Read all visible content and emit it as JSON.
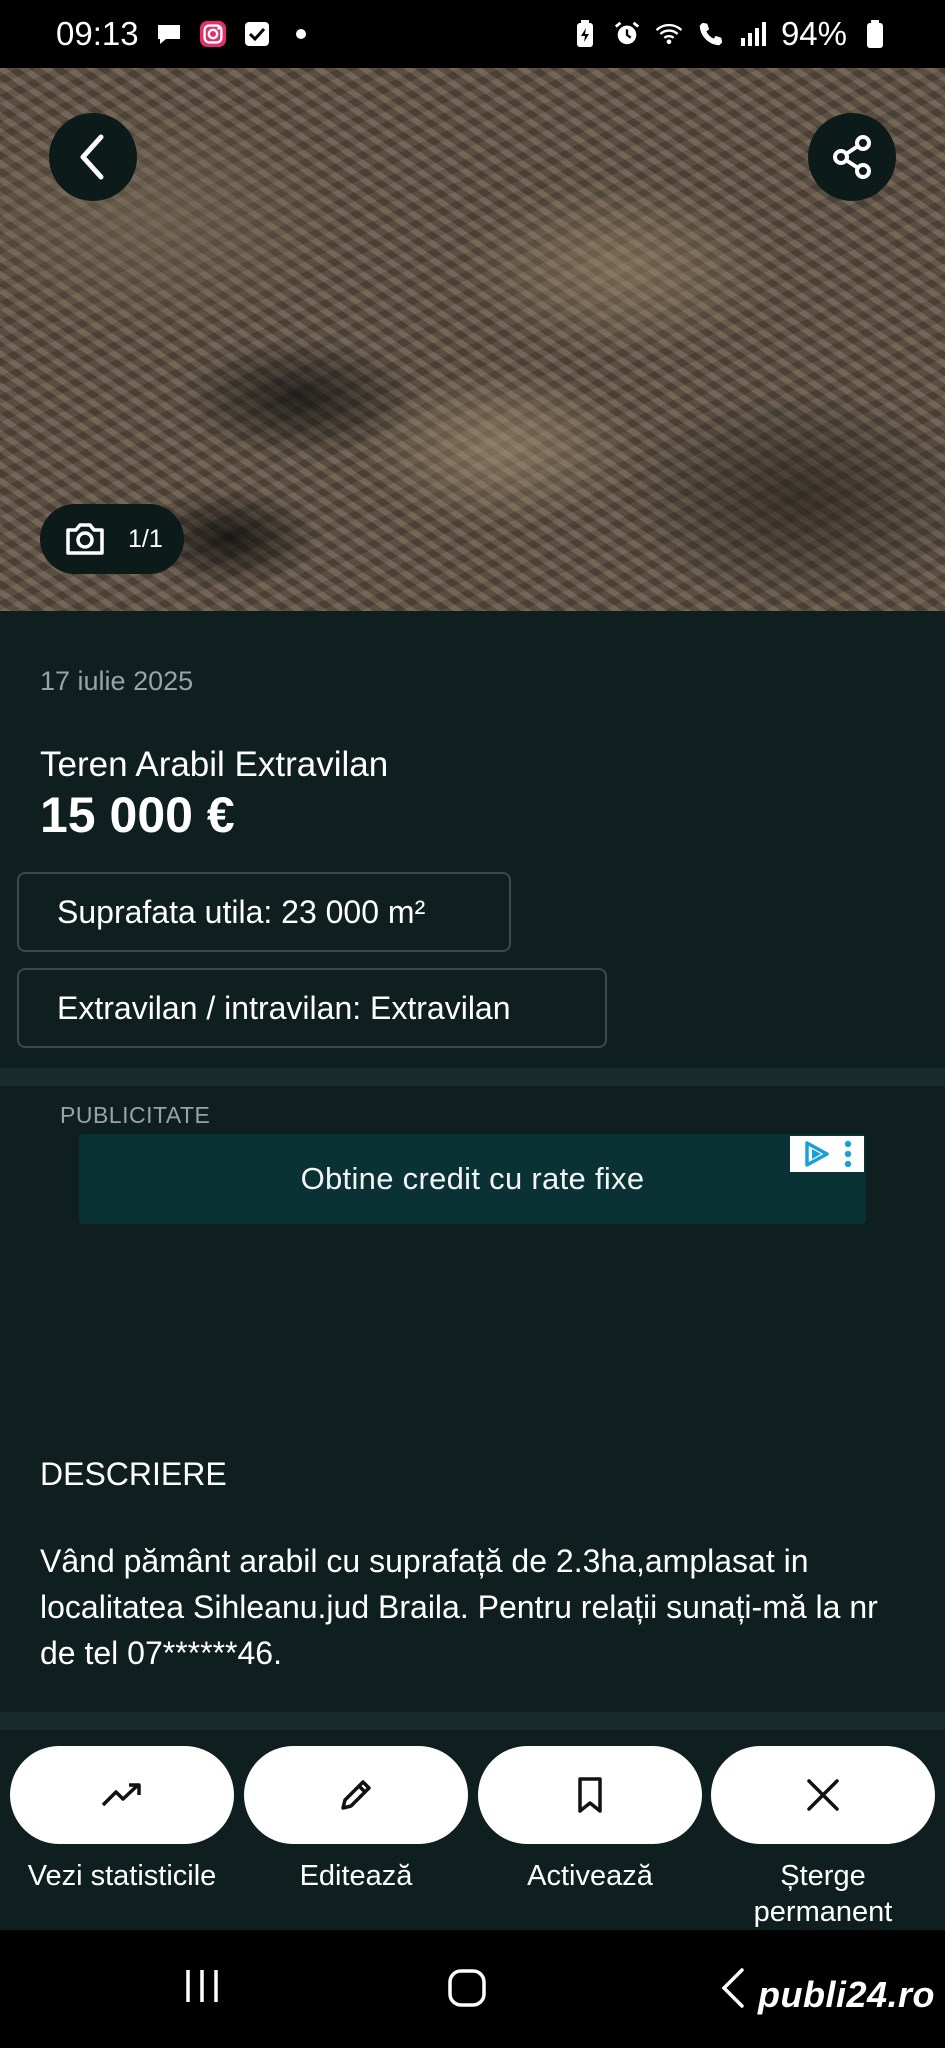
{
  "status_bar": {
    "time": "09:13",
    "battery": "94%",
    "icons": [
      "chat-icon",
      "instagram-icon",
      "check-icon",
      "battery-saver-icon",
      "alarm-icon",
      "wifi-icon",
      "wifi-call-icon",
      "signal-icon",
      "battery-icon"
    ]
  },
  "gallery": {
    "counter": "1/1"
  },
  "listing": {
    "date": "17 iulie 2025",
    "title": "Teren Arabil Extravilan",
    "price": "15 000 €",
    "attributes": [
      "Suprafata utila: 23 000 m²",
      "Extravilan / intravilan: Extravilan"
    ]
  },
  "ad": {
    "label": "PUBLICITATE",
    "text": "Obtine credit cu rate fixe"
  },
  "description": {
    "heading": "DESCRIERE",
    "text": "Vând pământ arabil cu suprafață de 2.3ha,amplasat in localitatea Sihleanu.jud Braila. Pentru relații sunați-mă la nr de tel 07******46."
  },
  "actions": [
    {
      "label": "Vezi statisticile",
      "icon": "trending-up-icon"
    },
    {
      "label": "Editează",
      "icon": "pencil-icon"
    },
    {
      "label": "Activează",
      "icon": "bookmark-icon"
    },
    {
      "label": "Șterge permanent",
      "icon": "close-icon"
    }
  ],
  "watermark": "publi24.ro"
}
